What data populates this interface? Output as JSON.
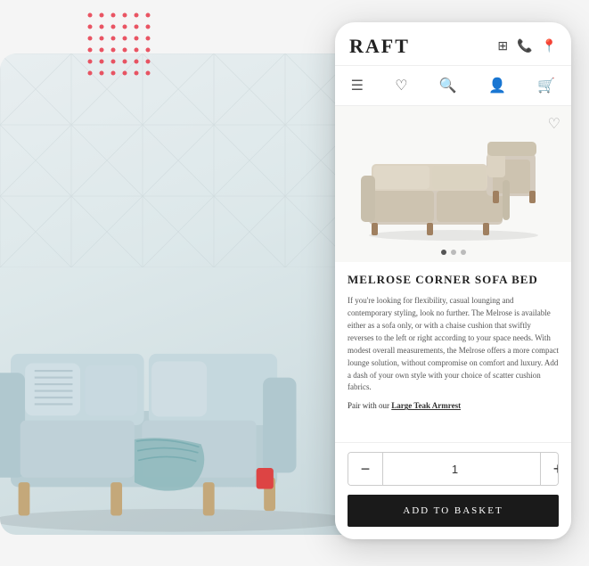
{
  "brand": {
    "name": "RAFT"
  },
  "header": {
    "icons": [
      "grid-icon",
      "phone-icon",
      "location-icon"
    ]
  },
  "nav": {
    "icons": [
      "menu-icon",
      "heart-icon",
      "search-icon",
      "user-icon",
      "cart-icon"
    ]
  },
  "product": {
    "title": "MELROSE CORNER SOFA BED",
    "description": "If you're looking for flexibility, casual lounging and contemporary styling, look no further. The Melrose is available either as a sofa only, or with a chaise cushion that swiftly reverses to the left or right according to your space needs. With modest overall measurements, the Melrose offers a more compact lounge solution, without compromise on comfort and luxury. Add a dash of your own style with your choice of scatter cushion fabrics.",
    "pair_text": "Pair with our ",
    "pair_link": "Large Teak Armrest",
    "quantity": "1",
    "add_to_basket_label": "ADD TO BASKET",
    "qty_minus": "−",
    "qty_plus": "+"
  },
  "dots": {
    "active_index": 0,
    "total": 3
  }
}
